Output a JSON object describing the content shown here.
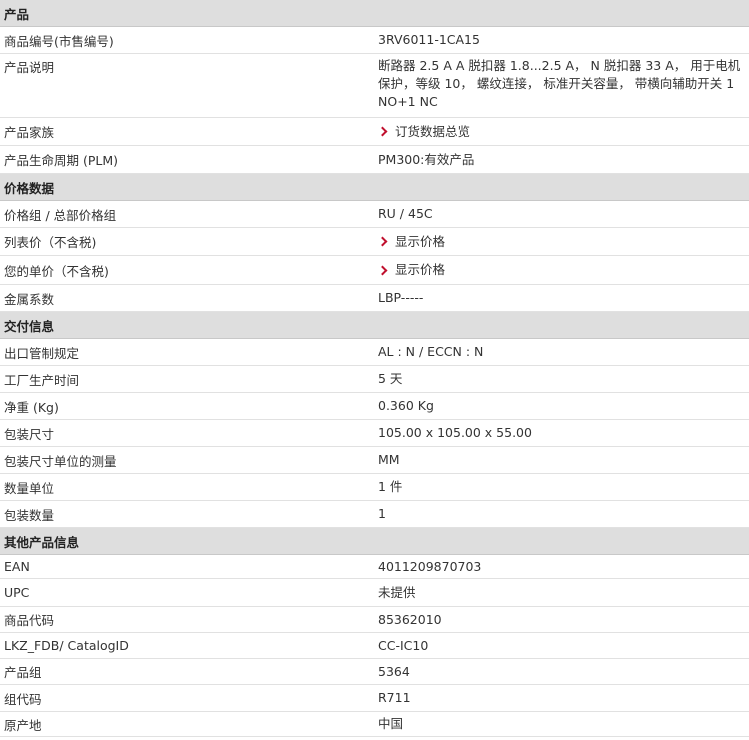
{
  "sections": [
    {
      "title": "产品",
      "rows": [
        {
          "label": "商品编号(市售编号)",
          "value": "3RV6011-1CA15"
        },
        {
          "label": "产品说明",
          "value": "断路器 2.5 A A 脱扣器 1.8...2.5 A， N 脱扣器 33 A， 用于电机保护，等级 10， 螺纹连接， 标准开关容量， 带横向辅助开关 1 NO+1 NC"
        },
        {
          "label": "产品家族",
          "value": "订货数据总览",
          "link": true
        },
        {
          "label": "产品生命周期 (PLM)",
          "value": "PM300:有效产品"
        }
      ]
    },
    {
      "title": "价格数据",
      "rows": [
        {
          "label": "价格组 / 总部价格组",
          "value": "RU / 45C"
        },
        {
          "label": "列表价（不含税)",
          "value": "显示价格",
          "link": true
        },
        {
          "label": "您的单价（不含税)",
          "value": "显示价格",
          "link": true
        },
        {
          "label": "金属系数",
          "value": "LBP-----"
        }
      ]
    },
    {
      "title": "交付信息",
      "rows": [
        {
          "label": "出口管制规定",
          "value": "AL : N / ECCN : N"
        },
        {
          "label": "工厂生产时间",
          "value": "5 天"
        },
        {
          "label": "净重 (Kg)",
          "value": "0.360 Kg"
        },
        {
          "label": "包装尺寸",
          "value": "105.00 x 105.00 x 55.00"
        },
        {
          "label": "包装尺寸单位的测量",
          "value": "MM"
        },
        {
          "label": "数量单位",
          "value": "1 件"
        },
        {
          "label": "包装数量",
          "value": "1"
        }
      ]
    },
    {
      "title": "其他产品信息",
      "rows": [
        {
          "label": "EAN",
          "value": "4011209870703"
        },
        {
          "label": "UPC",
          "value": "未提供"
        },
        {
          "label": "商品代码",
          "value": "85362010"
        },
        {
          "label": "LKZ_FDB/ CatalogID",
          "value": "CC-IC10"
        },
        {
          "label": "产品组",
          "value": "5364"
        },
        {
          "label": "组代码",
          "value": "R711"
        },
        {
          "label": "原产地",
          "value": "中国"
        }
      ]
    }
  ],
  "icons": {
    "link_chevron": "chevron-right-icon"
  },
  "colors": {
    "accent": "#c0102e",
    "section_bg": "#dedede"
  }
}
